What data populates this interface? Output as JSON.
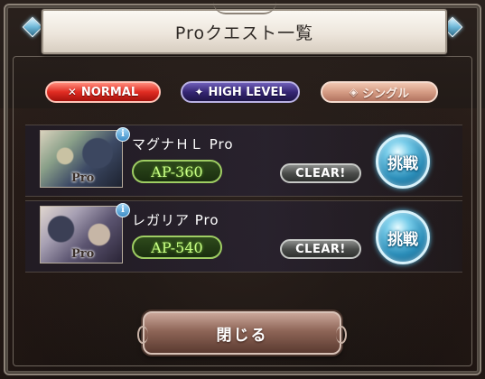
{
  "dialog": {
    "title": "Proクエスト一覧"
  },
  "tabs": [
    {
      "label": "NORMAL",
      "icon": "crossed-swords-icon",
      "color": "#e02c22"
    },
    {
      "label": "HIGH LEVEL",
      "icon": "dragon-icon",
      "color": "#352674"
    },
    {
      "label": "シングル",
      "icon": "single-player-icon",
      "color": "#d59c84"
    }
  ],
  "quests": [
    {
      "name": "マグナＨＬ Pro",
      "thumb_label": "Pro",
      "ap": "AP-360",
      "status": "CLEAR!",
      "action": "挑戦"
    },
    {
      "name": "レガリア Pro",
      "thumb_label": "Pro",
      "ap": "AP-540",
      "status": "CLEAR!",
      "action": "挑戦"
    }
  ],
  "footer": {
    "close_label": "閉じる"
  },
  "colors": {
    "ap_green": "#c9ff86",
    "challenge_blue": "#2b8db8"
  }
}
